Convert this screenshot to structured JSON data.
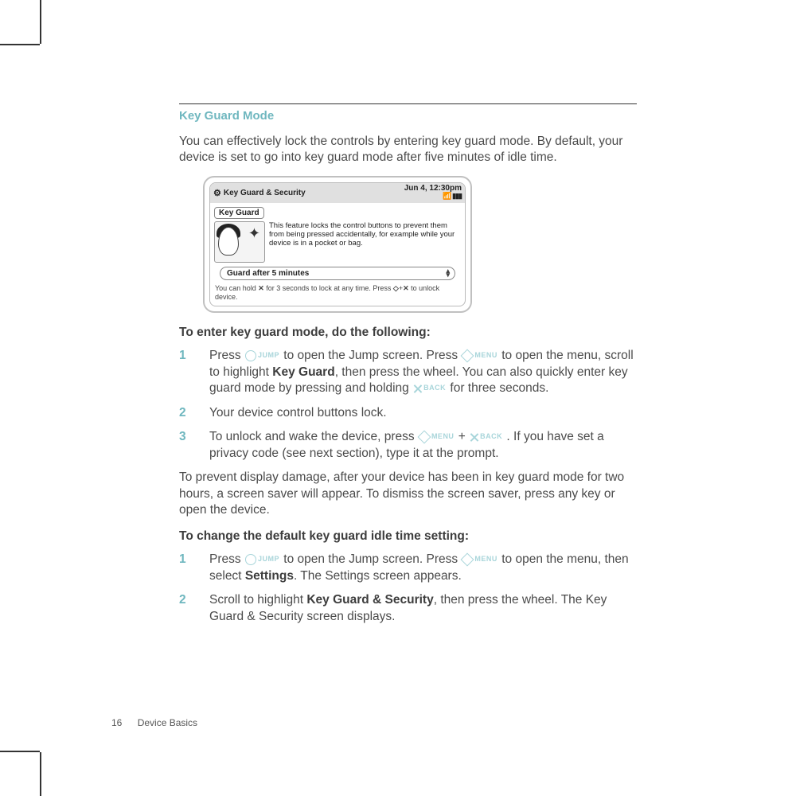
{
  "section_title": "Key Guard Mode",
  "intro": "You can effectively lock the controls by entering key guard mode. By default, your device is set to go into key guard mode after five minutes of idle time.",
  "icons": {
    "jump": "JUMP",
    "menu": "MENU",
    "back": "BACK"
  },
  "device": {
    "title": "Key Guard & Security",
    "clock": "Jun 4, 12:30pm",
    "panel_label": "Key Guard",
    "description": "This feature locks the control buttons to prevent them from being pressed accidentally, for example while your device is in a pocket or bag.",
    "dropdown": "Guard after 5 minutes",
    "hint1": "You can hold",
    "hint2": "for 3 seconds to lock at any time.  Press",
    "hint3": "to unlock device."
  },
  "enter": {
    "heading": "To enter key guard mode, do the following:",
    "steps": [
      {
        "n": "1",
        "a": "Press",
        "b": " to open the Jump screen. Press",
        "c": " to open the menu, scroll to highlight",
        "bold1": "Key Guard",
        "d": ", then press the wheel. You can also quickly enter key guard mode by pressing and holding",
        "e": " for three seconds."
      },
      {
        "n": "2",
        "a": "Your device control buttons lock."
      },
      {
        "n": "3",
        "a": "To unlock and wake the device, press",
        "plus": " + ",
        "b": ". If you have set a privacy code (see next section), type it at the prompt."
      }
    ]
  },
  "screensaver_note": "To prevent display damage, after your device has been in key guard mode for two hours, a screen saver will appear. To dismiss the screen saver, press any key or open the device.",
  "change": {
    "heading": "To change the default key guard idle time setting:",
    "steps": [
      {
        "n": "1",
        "a": "Press",
        "b": " to open the Jump screen. Press",
        "c": " to open the menu, then select",
        "bold1": "Settings",
        "d": ". The Settings screen appears."
      },
      {
        "n": "2",
        "a": "Scroll to highlight",
        "bold1": "Key Guard & Security",
        "b": ", then press the wheel. The Key Guard & Security screen displays."
      }
    ]
  },
  "footer": {
    "page": "16",
    "section": "Device Basics"
  }
}
